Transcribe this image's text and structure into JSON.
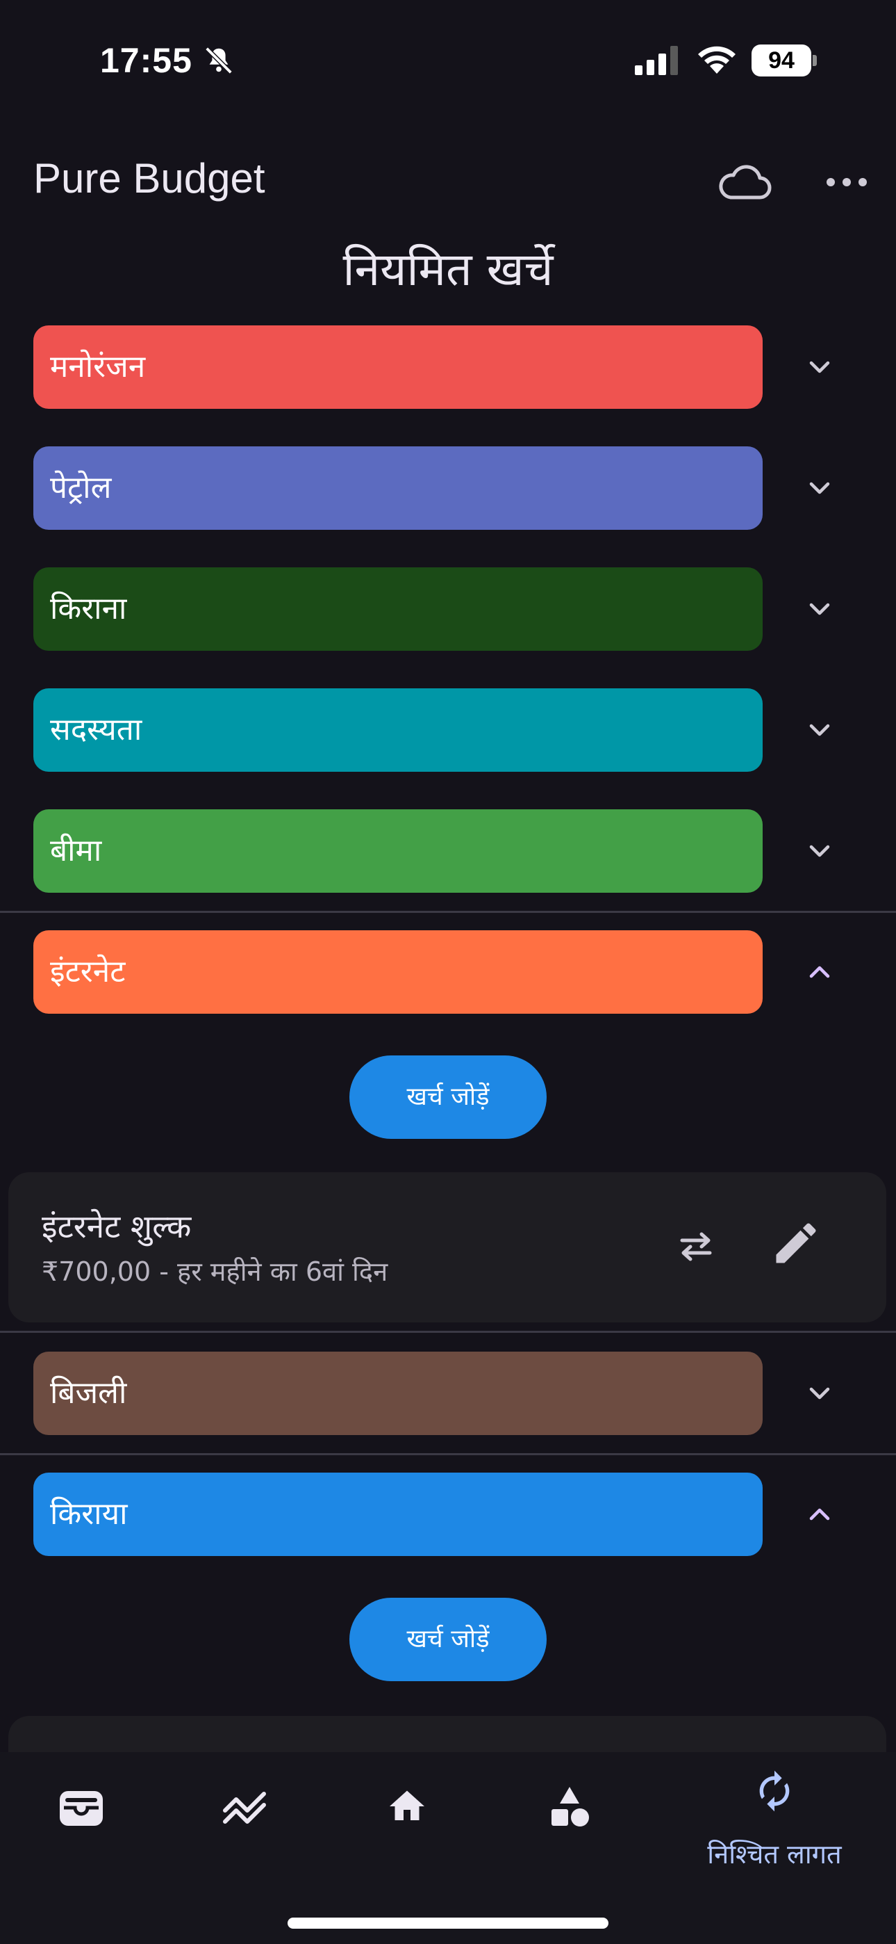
{
  "status_bar": {
    "time": "17:55",
    "battery": "94"
  },
  "app_bar": {
    "title": "Pure Budget"
  },
  "page": {
    "title": "नियमित खर्चे"
  },
  "categories": [
    {
      "label": "मनोरंजन",
      "color": "#ef5350",
      "expanded": false
    },
    {
      "label": "पेट्रोल",
      "color": "#5c6bc0",
      "expanded": false
    },
    {
      "label": "किराना",
      "color": "#1b4b17",
      "expanded": false
    },
    {
      "label": "सदस्यता",
      "color": "#0097a7",
      "expanded": false
    },
    {
      "label": "बीमा",
      "color": "#43a047",
      "expanded": false
    },
    {
      "label": "इंटरनेट",
      "color": "#ff7043",
      "expanded": true
    },
    {
      "label": "बिजली",
      "color": "#6d4c41",
      "expanded": false
    },
    {
      "label": "किराया",
      "color": "#1e88e5",
      "expanded": true
    }
  ],
  "actions": {
    "add_expense": "खर्च जोड़ें"
  },
  "expenses": [
    {
      "name": "इंटरनेट शुल्क",
      "detail": "₹700,00 - हर महीने का 6वां दिन"
    }
  ],
  "bottom_nav": {
    "items": [
      {
        "icon": "wallet-icon"
      },
      {
        "icon": "trending-icon"
      },
      {
        "icon": "home-icon"
      },
      {
        "icon": "categories-icon"
      },
      {
        "icon": "recurring-icon",
        "label": "निश्चित लागत",
        "active": true
      }
    ]
  },
  "colors": {
    "background": "#14121a",
    "accent": "#1e88e5",
    "chevron_up": "#d8bfff",
    "active_nav": "#b3c8ff"
  }
}
